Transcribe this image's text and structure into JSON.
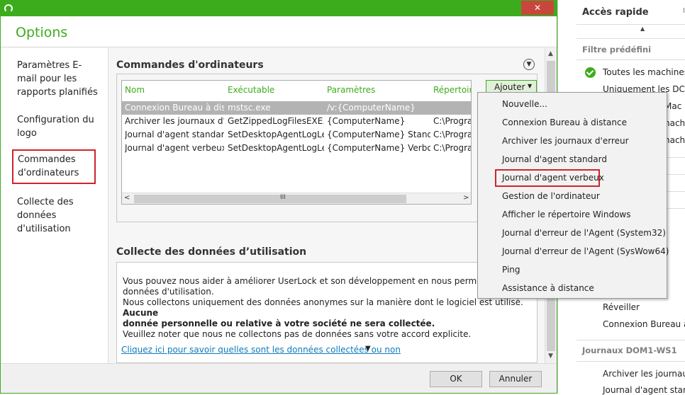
{
  "window": {
    "title": "Options",
    "close_label": "✕"
  },
  "nav": {
    "items": [
      {
        "label": "Paramètres E-mail pour les rapports planifiés"
      },
      {
        "label": "Configuration du logo"
      },
      {
        "label": "Commandes d'ordinateurs",
        "selected": true
      },
      {
        "label": "Collecte des données d'utilisation"
      }
    ]
  },
  "commands": {
    "title": "Commandes d'ordinateurs",
    "columns": [
      "Nom",
      "Exécutable",
      "Paramètres",
      "Répertoire"
    ],
    "rows": [
      [
        "Connexion Bureau à dist...",
        "mstsc.exe",
        "/v:{ComputerName}",
        ""
      ],
      [
        "Archiver les journaux d'e...",
        "GetZippedLogFilesEXE.e...",
        "{ComputerName}",
        "C:\\Progran"
      ],
      [
        "Journal d'agent standard",
        "SetDesktopAgentLogLe...",
        "{ComputerName} Standard",
        "C:\\Progran"
      ],
      [
        "Journal d'agent verbeux",
        "SetDesktopAgentLogLe...",
        "{ComputerName} Verbose",
        "C:\\Progran"
      ]
    ],
    "scroll_grip": "III",
    "add_label": "Ajouter"
  },
  "usage": {
    "title": "Collecte des données d’utilisation",
    "line1": "Vous pouvez nous aider à améliorer UserLock et son développement en nous permettant de col",
    "line2": "données d'utilisation.",
    "line3": "Nous collectons uniquement des données anonymes sur la manière dont le logiciel est utilisé.",
    "line3_bold": "Aucune",
    "line4_bold": "donnée personnelle ou relative à votre société ne sera collectée.",
    "line5": "Veuillez noter que nous ne collectons pas de données sans votre accord explicite.",
    "link": "Cliquez ici pour savoir quelles sont les données collectées ou non"
  },
  "footer": {
    "ok": "OK",
    "cancel": "Annuler"
  },
  "dropdown": {
    "items": [
      "Nouvelle...",
      "Connexion Bureau à distance",
      "Archiver les journaux d'erreur",
      "Journal d'agent standard",
      "Journal d'agent verbeux",
      "Gestion de l'ordinateur",
      "Afficher le répertoire Windows",
      "Journal d'erreur de l'Agent (System32)",
      "Journal d'erreur de l'Agent (SysWow64)",
      "Ping",
      "Assistance à distance"
    ],
    "highlighted": "Journal d'agent verbeux"
  },
  "quick_access": {
    "title": "Accès rapide",
    "title_cut": "I",
    "filter_title": "Filtre prédéfini",
    "filters": [
      "Toutes les machines",
      "Uniquement les DC"
    ],
    "peeks": [
      "Mac",
      "nach",
      "nach"
    ],
    "actions": [
      "Réveiller",
      "Connexion Bureau à dis"
    ],
    "logs_title": "Journaux DOM1-WS1",
    "logs": [
      "Archiver les journaux c",
      "Journal d'agent standa"
    ]
  },
  "colors": {
    "accent": "#3dac1c",
    "highlight_border": "#d0242d",
    "link": "#0e7bbd",
    "close": "#c9463d"
  }
}
